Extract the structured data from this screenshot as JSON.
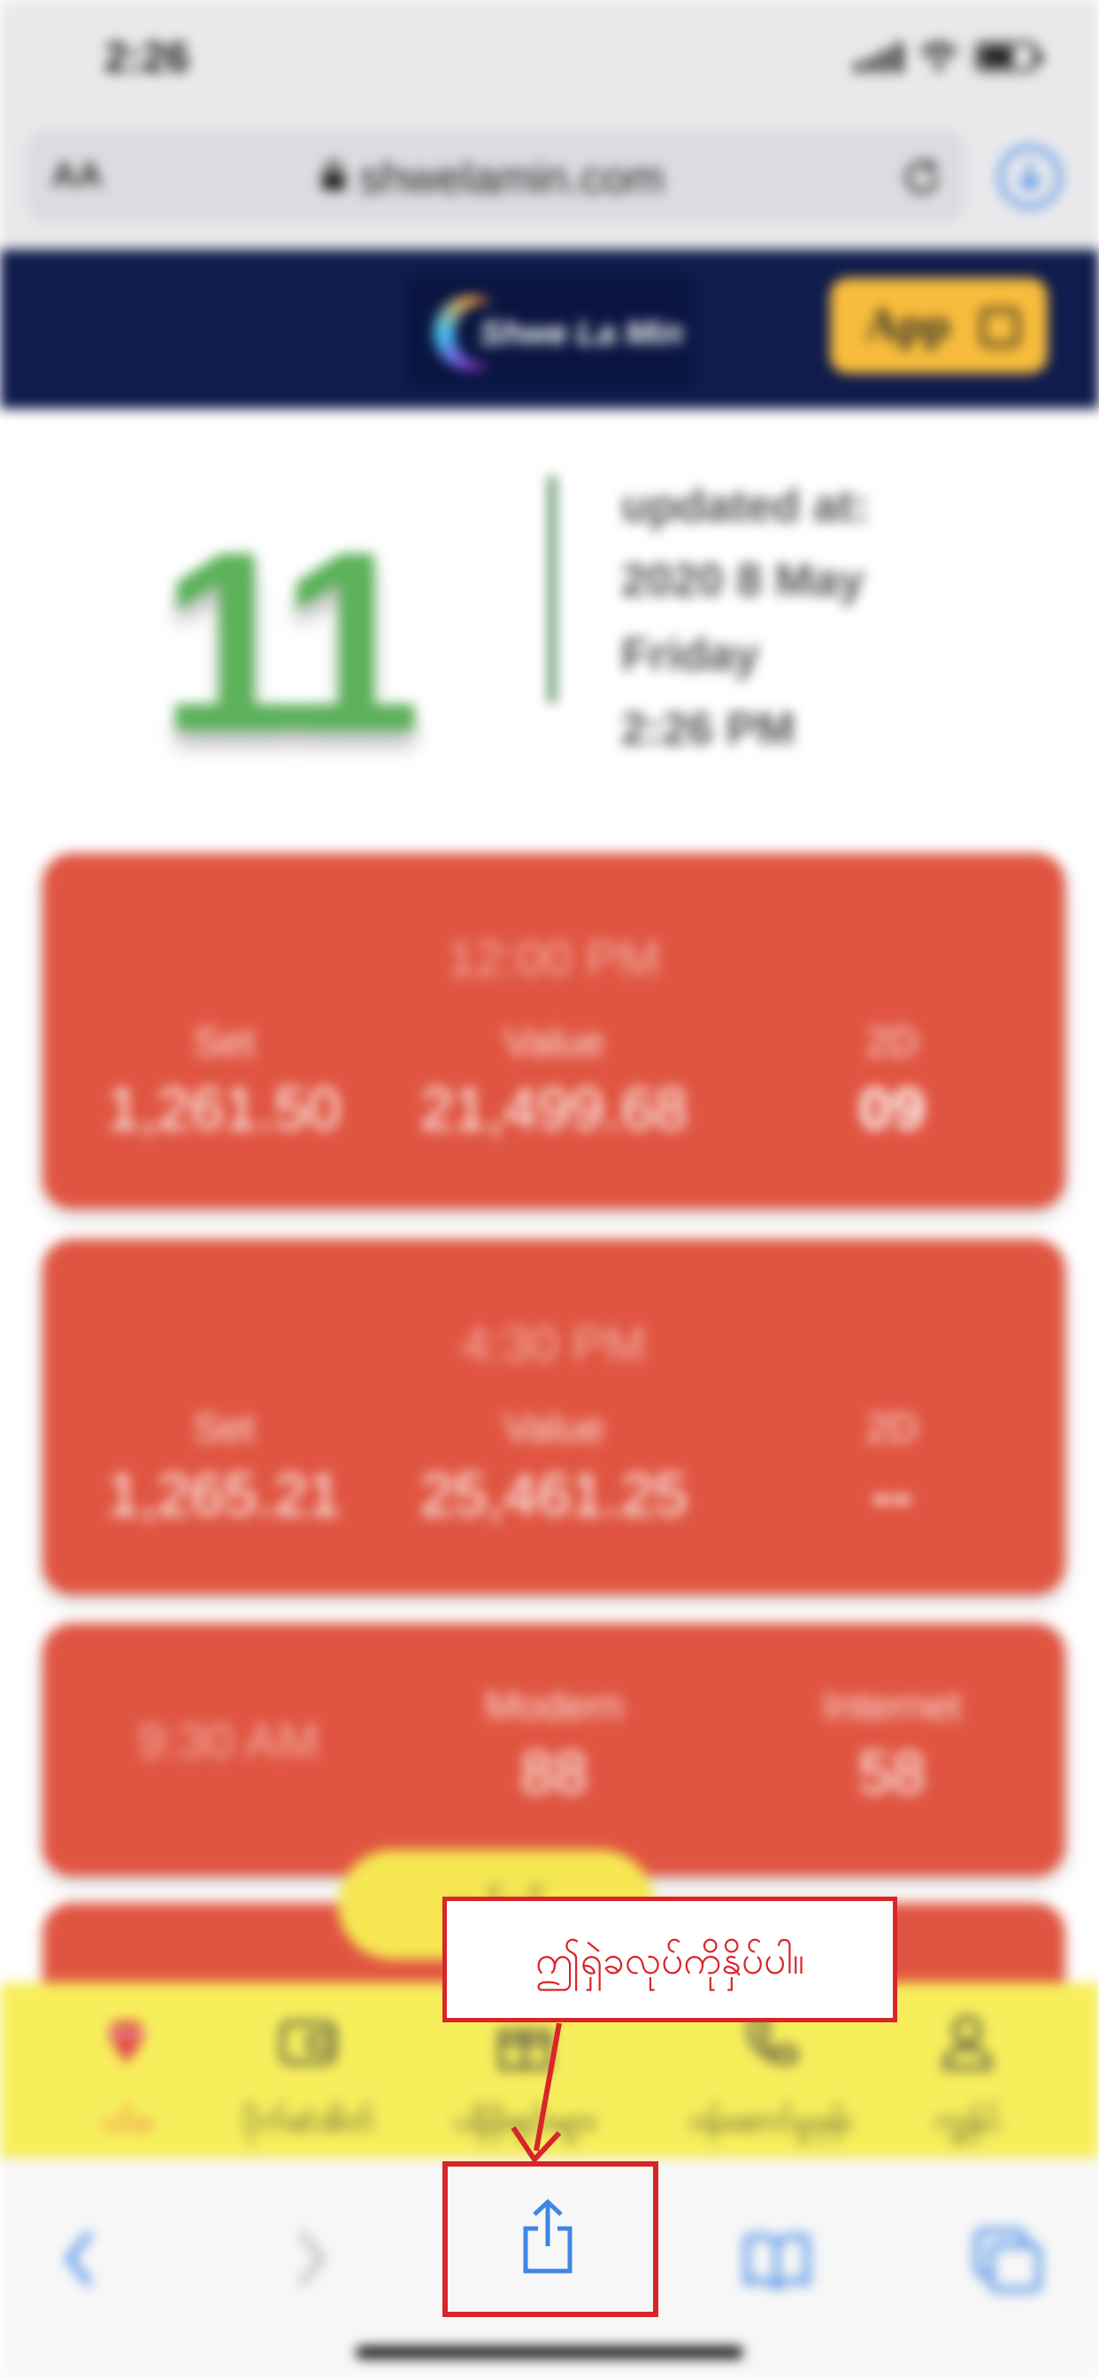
{
  "status_bar": {
    "time": "2:26"
  },
  "browser": {
    "aa_label": "AA",
    "url": "shwelamin.com"
  },
  "site_header": {
    "logo_text": "Shwe La Min",
    "app_button_label": "App"
  },
  "result": {
    "number": "11",
    "updated_label": "updated at:",
    "updated_date": "2020 8 May",
    "updated_day": "Friday",
    "updated_time": "2:26 PM"
  },
  "cards": [
    {
      "time": "12:00 PM",
      "set_label": "Set",
      "set_value": "1,261.50",
      "value_label": "Value",
      "value_value": "21,499.68",
      "d2_label": "2D",
      "d2_value": "09"
    },
    {
      "time": "4:30 PM",
      "set_label": "Set",
      "set_value": "1,265.21",
      "value_label": "Value",
      "value_value": "25,461.25",
      "d2_label": "2D",
      "d2_value": "--"
    },
    {
      "time": "9:30 AM",
      "modern_label": "Modern",
      "modern_value": "88",
      "internet_label": "Internet",
      "internet_value": "58"
    }
  ],
  "pill_text": "ဝယ်ရန်",
  "bottom_nav": [
    {
      "label": "ပင်မ",
      "icon": "diamond-icon",
      "active": true
    },
    {
      "label": "ပိုက်ဆံအိတ်",
      "icon": "wallet-icon",
      "active": false
    },
    {
      "label": "ပရိုမိုးရှင်းများ",
      "icon": "gift-icon",
      "active": false
    },
    {
      "label": "ဝန်ဆောင်မှုဖုန်း",
      "icon": "phone-icon",
      "active": false
    },
    {
      "label": "ကျွန်ုပ်",
      "icon": "user-icon",
      "active": false
    }
  ],
  "annotation": {
    "callout_text": "ဤရှဲခလုပ်ကိုနှိပ်ပါ။",
    "color": "#d8252a"
  },
  "colors": {
    "header_bg": "#0f1c4d",
    "card_red": "#e05541",
    "number_green": "#5cb15a",
    "nav_yellow": "#f7ee5c",
    "app_button": "#f7bc3b",
    "safari_blue": "#3d86e6"
  }
}
